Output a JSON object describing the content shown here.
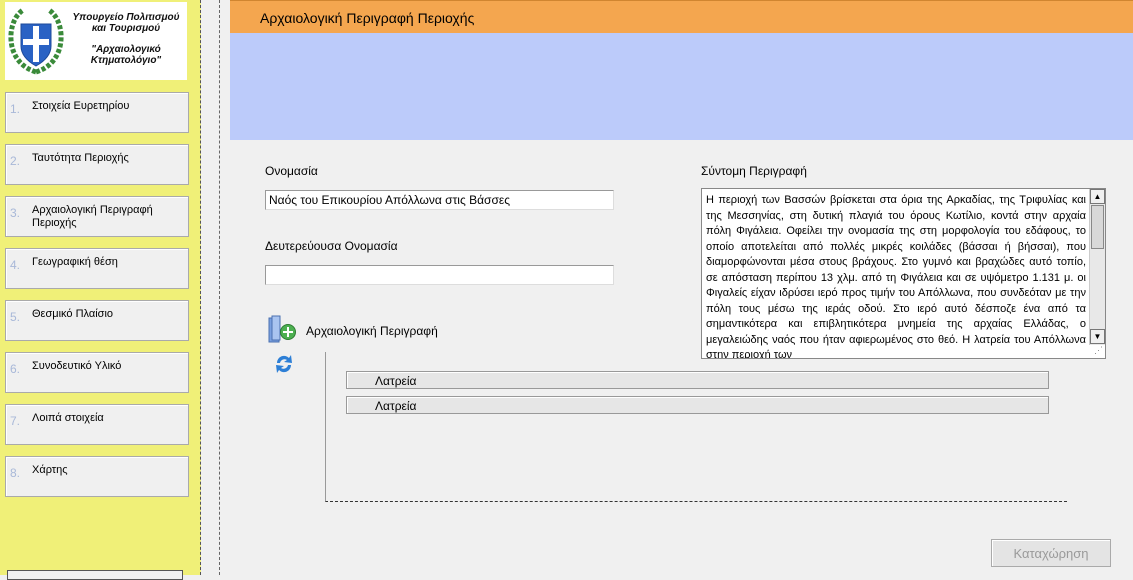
{
  "logo": {
    "ministry_line1": "Υπουργείο Πολιτισμού",
    "ministry_line2": "και Τουρισμού",
    "project_line1": "\"Αρχαιολογικό",
    "project_line2": "Κτηματολόγιο\""
  },
  "sidebar": {
    "items": [
      {
        "num": "1.",
        "label": "Στοιχεία Ευρετηρίου"
      },
      {
        "num": "2.",
        "label": "Ταυτότητα Περιοχής"
      },
      {
        "num": "3.",
        "label": "Αρχαιολογική Περιγραφή Περιοχής"
      },
      {
        "num": "4.",
        "label": "Γεωγραφική θέση"
      },
      {
        "num": "5.",
        "label": "Θεσμικό Πλαίσιο"
      },
      {
        "num": "6.",
        "label": "Συνοδευτικό Υλικό"
      },
      {
        "num": "7.",
        "label": "Λοιπά στοιχεία"
      },
      {
        "num": "8.",
        "label": "Χάρτης"
      }
    ]
  },
  "header": {
    "title": "Αρχαιολογική Περιγραφή Περιοχής"
  },
  "form": {
    "name_label": "Ονομασία",
    "name_value": "Ναός του Επικουρίου Απόλλωνα στις Βάσσες",
    "secondary_name_label": "Δευτερεύουσα Ονομασία",
    "secondary_name_value": "",
    "short_desc_label": "Σύντομη Περιγραφή",
    "short_desc_value": "Η περιοχή των Βασσών βρίσκεται στα όρια της Αρκαδίας, της Τριφυλίας και της Μεσσηνίας, στη δυτική πλαγιά του όρους Κωτίλιο, κοντά στην αρχαία πόλη Φιγάλεια. Οφείλει την ονομασία της στη μορφολογία του εδάφους, το οποίο αποτελείται από πολλές μικρές κοιλάδες (βάσσαι ή βήσσαι), που διαμορφώνονται μέσα στους βράχους. Στο γυμνό και βραχώδες αυτό τοπίο, σε απόσταση περίπου 13 χλμ. από τη Φιγάλεια και σε υψόμετρο 1.131 μ. οι Φιγαλείς είχαν ιδρύσει ιερό προς τιμήν του Απόλλωνα, που συνδεόταν με την πόλη τους μέσω της ιεράς οδού. Στο ιερό αυτό δέσποζε ένα από τα σημαντικότερα και επιβλητικότερα μνημεία της αρχαίας Ελλάδας, ο μεγαλειώδης ναός που ήταν αφιερωμένος στο θεό. Η λατρεία του Απόλλωνα στην περιοχή των"
  },
  "arch_description": {
    "label": "Αρχαιολογική Περιγραφή",
    "rows": [
      {
        "label": "Λατρεία"
      },
      {
        "label": "Λατρεία"
      }
    ]
  },
  "actions": {
    "save_label": "Καταχώρηση"
  },
  "colors": {
    "sidebar_bg": "#f0f078",
    "header_bg": "#f4a64f",
    "band_bg": "#bccbfa"
  }
}
